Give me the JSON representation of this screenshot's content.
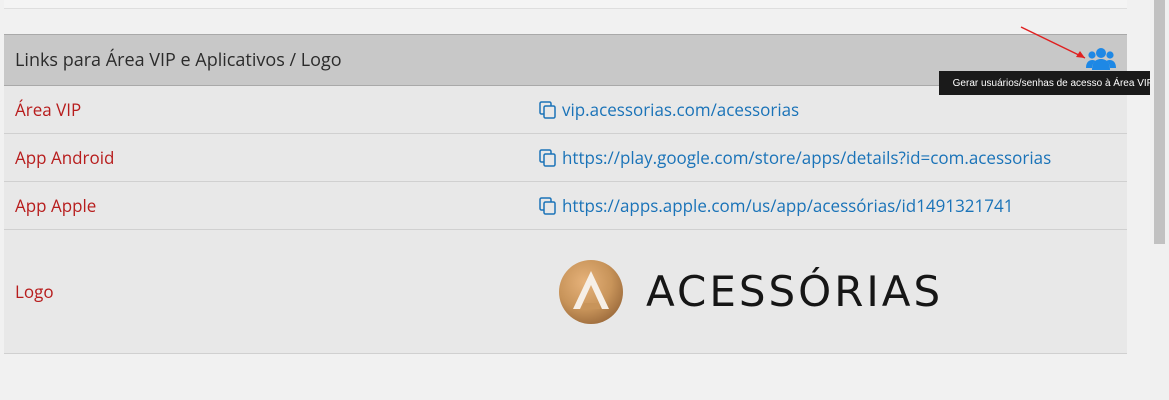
{
  "panel": {
    "title": "Links para Área VIP e Aplicativos / Logo",
    "generate_button_icon": "users-icon",
    "tooltip": "Gerar usuários/senhas de acesso à Área VIP"
  },
  "rows": [
    {
      "label": "Área VIP",
      "value": "vip.acessorias.com/acessorias",
      "icon": "copy-icon"
    },
    {
      "label": "App Android",
      "value": "https://play.google.com/store/apps/details?id=com.acessorias",
      "icon": "copy-icon"
    },
    {
      "label": "App Apple",
      "value": "https://apps.apple.com/us/app/acessórias/id1491321741",
      "icon": "copy-icon"
    }
  ],
  "logo_row": {
    "label": "Logo",
    "logo_text": "ACESSÓRIAS"
  },
  "colors": {
    "label_red": "#b71c1c",
    "link_blue": "#1a73b8",
    "icon_blue": "#1e88e5",
    "header_bg": "#c8c8c8",
    "row_bg": "#e8e8e8",
    "logo_gold": "#c8945a"
  }
}
